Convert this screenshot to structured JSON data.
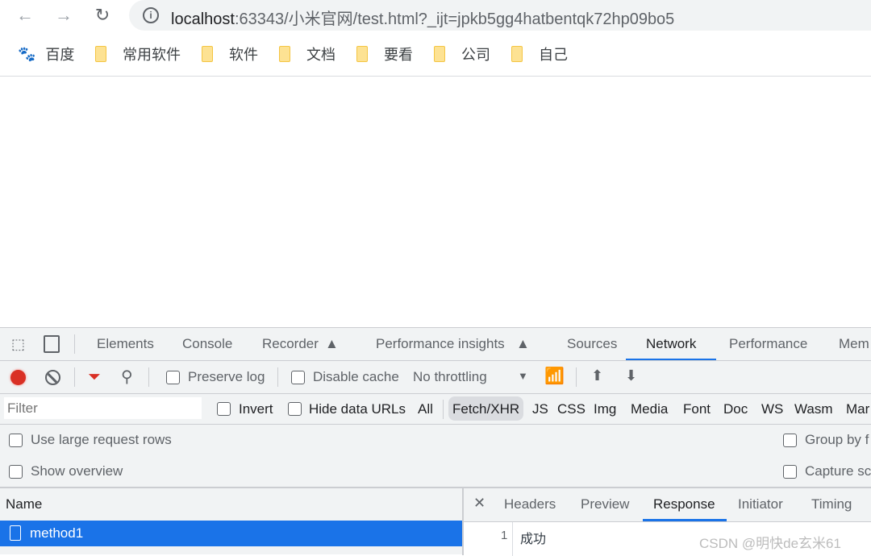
{
  "browser": {
    "url_host": "localhost",
    "url_rest": ":63343/小米官网/test.html?_ijt=jpkb5gg4hatbentqk72hp09bo5",
    "bookmarks": [
      {
        "label": "百度",
        "icon": "baidu-icon"
      },
      {
        "label": "常用软件",
        "icon": "folder-icon"
      },
      {
        "label": "软件",
        "icon": "folder-icon"
      },
      {
        "label": "文档",
        "icon": "folder-icon"
      },
      {
        "label": "要看",
        "icon": "folder-icon"
      },
      {
        "label": "公司",
        "icon": "folder-icon"
      },
      {
        "label": "自己",
        "icon": "folder-icon"
      }
    ]
  },
  "devtools": {
    "tabs": [
      "Elements",
      "Console",
      "Recorder",
      "Performance insights",
      "Sources",
      "Network",
      "Performance",
      "Mem"
    ],
    "active_tab": "Network",
    "toolbar": {
      "preserve_log": "Preserve log",
      "disable_cache": "Disable cache",
      "throttling": "No throttling"
    },
    "filter": {
      "placeholder": "Filter",
      "invert": "Invert",
      "hide_data_urls": "Hide data URLs",
      "types": [
        "All",
        "Fetch/XHR",
        "JS",
        "CSS",
        "Img",
        "Media",
        "Font",
        "Doc",
        "WS",
        "Wasm",
        "Mar"
      ],
      "active_type": "Fetch/XHR"
    },
    "settings": {
      "large_rows": "Use large request rows",
      "show_overview": "Show overview",
      "group_by": "Group by f",
      "capture": "Capture sc"
    },
    "requests": {
      "header": "Name",
      "items": [
        {
          "name": "method1",
          "selected": true
        }
      ]
    },
    "detail": {
      "tabs": [
        "Headers",
        "Preview",
        "Response",
        "Initiator",
        "Timing"
      ],
      "active_tab": "Response",
      "response_lines": [
        {
          "num": "1",
          "text": "成功"
        }
      ]
    },
    "accent": "#1a73e8",
    "record_color": "#d93025"
  },
  "watermark": "CSDN @明快de玄米61"
}
